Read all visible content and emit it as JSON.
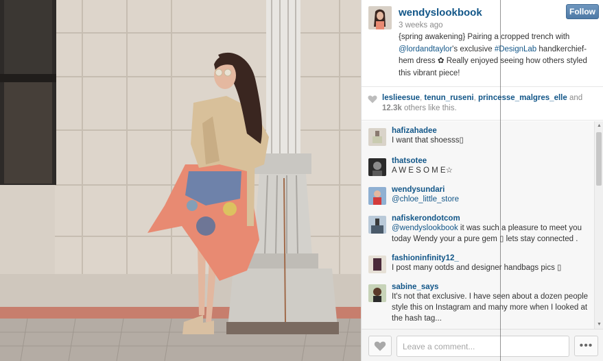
{
  "post": {
    "username": "wendyslookbook",
    "time_ago": "3 weeks ago",
    "follow_label": "Follow",
    "caption_part1": "{spring awakening} Pairing a cropped trench with ",
    "caption_mention1": "@lordandtaylor",
    "caption_part2": "'s exclusive ",
    "caption_mention2": "#DesignLab",
    "caption_part3": " handkerchief-hem dress ✿ Really enjoyed seeing how others styled this vibrant piece!"
  },
  "likes": {
    "user1": "leslieesue",
    "user2": "tenun_ruseni",
    "user3": "princesse_malgres_elle",
    "and_text": " and",
    "count": "12.3k",
    "suffix": " others like this."
  },
  "comments": [
    {
      "user": "hafizahadee",
      "text": "I want that shoesss▯"
    },
    {
      "user": "thatsotee",
      "text": "A W E S O M E☆"
    },
    {
      "user": "wendysundari",
      "text": "@chloe_little_store"
    },
    {
      "user": "nafiskerondotcom",
      "text_mention": "@wendyslookbook",
      "text": " it was such a pleasure to meet you today Wendy your a pure gem ▯ lets stay connected ."
    },
    {
      "user": "fashioninfinity12_",
      "text": "I post many ootds and designer handbags pics ▯"
    },
    {
      "user": "sabine_says",
      "text": "It's not that exclusive. I have seen about a dozen people style this on Instagram and many more when I looked at the hash tag..."
    }
  ],
  "composer": {
    "placeholder": "Leave a comment...",
    "more_label": "•••"
  },
  "colors": {
    "link": "#125688",
    "follow_button": "#5a84ae"
  },
  "icons": [
    "heart-icon",
    "more-icon"
  ]
}
